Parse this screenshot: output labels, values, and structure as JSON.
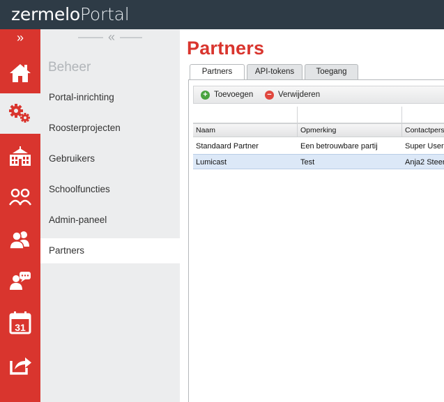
{
  "brand": {
    "part1": "zermelo",
    "part2": "Portal"
  },
  "iconbar": {
    "collapse_glyph": "»",
    "items": [
      {
        "icon": "home-icon"
      },
      {
        "icon": "gears-icon",
        "active": true
      },
      {
        "icon": "school-icon"
      },
      {
        "icon": "students-icon"
      },
      {
        "icon": "users-icon"
      },
      {
        "icon": "support-chat-icon"
      },
      {
        "icon": "calendar-icon",
        "text": "31"
      },
      {
        "icon": "share-icon"
      }
    ]
  },
  "sidebar": {
    "collapse_glyph": "«",
    "section": "Beheer",
    "items": [
      {
        "label": "Portal-inrichting"
      },
      {
        "label": "Roosterprojecten"
      },
      {
        "label": "Gebruikers"
      },
      {
        "label": "Schoolfuncties"
      },
      {
        "label": "Admin-paneel"
      },
      {
        "label": "Partners",
        "active": true
      }
    ]
  },
  "main": {
    "title": "Partners",
    "tabs": [
      {
        "label": "Partners",
        "active": true
      },
      {
        "label": "API-tokens"
      },
      {
        "label": "Toegang"
      }
    ],
    "toolbar": {
      "add_label": "Toevoegen",
      "add_icon": "plus-icon",
      "delete_label": "Verwijderen",
      "delete_icon": "minus-icon"
    },
    "table": {
      "columns": [
        "Naam",
        "Opmerking",
        "Contactpers"
      ],
      "rows": [
        [
          "Standaard Partner",
          "Een betrouwbare partij",
          "Super User"
        ],
        [
          "Lumicast",
          "Test",
          "Anja2 Steen"
        ]
      ],
      "selected_row": 1
    }
  },
  "colors": {
    "accent": "#d9352e",
    "topbar": "#2e3b46",
    "sidebar": "#ecedee",
    "selected_row": "#dce8f7"
  }
}
